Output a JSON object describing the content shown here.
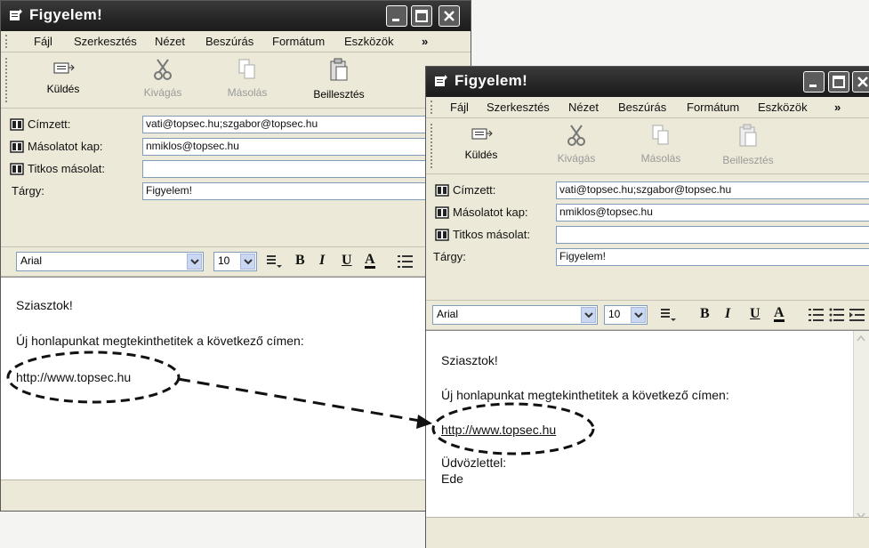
{
  "windows": [
    {
      "title": "Figyelem!",
      "menu": [
        "Fájl",
        "Szerkesztés",
        "Nézet",
        "Beszúrás",
        "Formátum",
        "Eszközök"
      ],
      "menu_more": "»",
      "toolbar": {
        "send": "Küldés",
        "cut": "Kivágás",
        "copy": "Másolás",
        "paste": "Beillesztés"
      },
      "header": {
        "to_label": "Címzett:",
        "to_value": "vati@topsec.hu;szgabor@topsec.hu",
        "cc_label": "Másolatot kap:",
        "cc_value": "nmiklos@topsec.hu",
        "bcc_label": "Titkos másolat:",
        "bcc_value": "",
        "subject_label": "Tárgy:",
        "subject_value": "Figyelem!"
      },
      "format": {
        "font": "Arial",
        "size": "10",
        "bold": "B",
        "italic": "I",
        "underline": "U",
        "color": "A"
      },
      "body": {
        "greeting": "Sziasztok!",
        "line": "Új honlapunkat megtekinthetitek a következő címen:",
        "url": "http://www.topsec.hu"
      }
    },
    {
      "title": "Figyelem!",
      "menu": [
        "Fájl",
        "Szerkesztés",
        "Nézet",
        "Beszúrás",
        "Formátum",
        "Eszközök"
      ],
      "menu_more": "»",
      "toolbar": {
        "send": "Küldés",
        "cut": "Kivágás",
        "copy": "Másolás",
        "paste": "Beillesztés"
      },
      "header": {
        "to_label": "Címzett:",
        "to_value": "vati@topsec.hu;szgabor@topsec.hu",
        "cc_label": "Másolatot kap:",
        "cc_value": "nmiklos@topsec.hu",
        "bcc_label": "Titkos másolat:",
        "bcc_value": "",
        "subject_label": "Tárgy:",
        "subject_value": "Figyelem!"
      },
      "format": {
        "font": "Arial",
        "size": "10",
        "bold": "B",
        "italic": "I",
        "underline": "U",
        "color": "A"
      },
      "body": {
        "greeting": "Sziasztok!",
        "line": "Új honlapunkat megtekinthetitek a következő címen:",
        "url": "http://www.topsec.hu",
        "closing": "Üdvözlettel:",
        "signature": "Ede"
      }
    }
  ],
  "colors": {
    "titlebar": "#262626",
    "window_bg": "#ece9d8",
    "input_border": "#7f9db9"
  }
}
